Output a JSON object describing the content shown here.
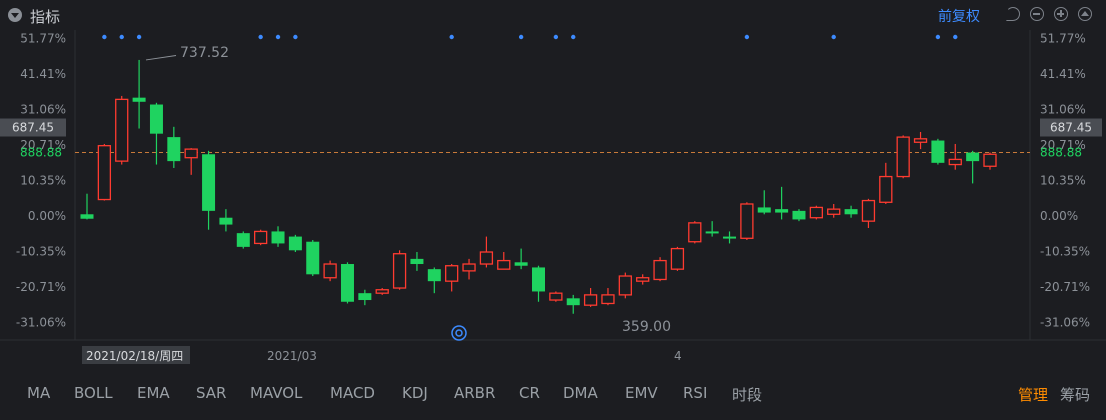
{
  "toolbar": {
    "title": "指标",
    "adjust_label": "前复权",
    "icons": [
      "collapse-icon",
      "undo-icon",
      "zoom-out-icon",
      "zoom-in-icon",
      "expand-icon"
    ]
  },
  "price_labels": {
    "high_label": "737.52",
    "low_label": "359.00",
    "current_price": "687.45",
    "dashed_price_label": "888.88"
  },
  "y_axis": {
    "ticks": [
      "51.77%",
      "41.41%",
      "31.06%",
      "20.71%",
      "10.35%",
      "0.00%",
      "-10.35%",
      "-20.71%",
      "-31.06%"
    ]
  },
  "x_axis": {
    "labels": [
      "2021/02/18/周四",
      "2021/03",
      "4"
    ]
  },
  "indicators": [
    "MA",
    "BOLL",
    "EMA",
    "SAR",
    "MAVOL",
    "MACD",
    "KDJ",
    "ARBR",
    "CR",
    "DMA",
    "EMV",
    "RSI",
    "时段"
  ],
  "accent_buttons": [
    "管理",
    "筹码"
  ],
  "colors": {
    "up": "#ff3b30",
    "down": "#1fd360",
    "accent": "#3d8bff",
    "dashed": "#c87a3a",
    "orange": "#ff8c00"
  },
  "chart_data": {
    "type": "candlestick",
    "y_unit": "percent change",
    "ylim": [
      -36,
      56
    ],
    "candles": [
      {
        "o": 0.5,
        "c": -0.8,
        "h": 6.5,
        "l": -1.0
      },
      {
        "o": 4.8,
        "c": 20.5,
        "h": 21.0,
        "l": 4.5
      },
      {
        "o": 16.0,
        "c": 34.0,
        "h": 35.0,
        "l": 15.0
      },
      {
        "o": 34.5,
        "c": 33.3,
        "h": 45.5,
        "l": 25.5
      },
      {
        "o": 32.5,
        "c": 24.0,
        "h": 33.0,
        "l": 15.0
      },
      {
        "o": 23.0,
        "c": 16.0,
        "h": 26.0,
        "l": 14.0
      },
      {
        "o": 17.0,
        "c": 19.5,
        "h": 19.8,
        "l": 12.0
      },
      {
        "o": 18.0,
        "c": 1.5,
        "h": 19.0,
        "l": -4.0
      },
      {
        "o": -0.5,
        "c": -2.5,
        "h": 2.0,
        "l": -4.5
      },
      {
        "o": -5.0,
        "c": -9.0,
        "h": -4.5,
        "l": -9.5
      },
      {
        "o": -8.0,
        "c": -4.5,
        "h": -4.0,
        "l": -8.5
      },
      {
        "o": -4.5,
        "c": -8.0,
        "h": -3.0,
        "l": -9.0
      },
      {
        "o": -6.0,
        "c": -10.0,
        "h": -5.5,
        "l": -10.5
      },
      {
        "o": -7.5,
        "c": -17.0,
        "h": -7.0,
        "l": -17.5
      },
      {
        "o": -18.0,
        "c": -14.0,
        "h": -13.0,
        "l": -19.0
      },
      {
        "o": -14.0,
        "c": -25.0,
        "h": -13.5,
        "l": -25.5
      },
      {
        "o": -22.5,
        "c": -24.5,
        "h": -21.5,
        "l": -26.0
      },
      {
        "o": -22.5,
        "c": -21.5,
        "h": -21.0,
        "l": -23.0
      },
      {
        "o": -21.0,
        "c": -11.0,
        "h": -10.0,
        "l": -21.5
      },
      {
        "o": -12.5,
        "c": -14.0,
        "h": -10.5,
        "l": -16.0
      },
      {
        "o": -15.5,
        "c": -19.0,
        "h": -15.0,
        "l": -22.5
      },
      {
        "o": -19.0,
        "c": -14.5,
        "h": -14.0,
        "l": -22.0
      },
      {
        "o": -16.0,
        "c": -14.0,
        "h": -12.5,
        "l": -18.5
      },
      {
        "o": -14.0,
        "c": -10.5,
        "h": -6.0,
        "l": -15.0
      },
      {
        "o": -15.5,
        "c": -13.0,
        "h": -10.5,
        "l": -15.5
      },
      {
        "o": -13.5,
        "c": -14.5,
        "h": -9.5,
        "l": -15.5
      },
      {
        "o": -15.0,
        "c": -22.0,
        "h": -14.5,
        "l": -25.0
      },
      {
        "o": -24.5,
        "c": -22.5,
        "h": -22.0,
        "l": -25.0
      },
      {
        "o": -24.0,
        "c": -26.0,
        "h": -23.0,
        "l": -28.5
      },
      {
        "o": -26.0,
        "c": -23.0,
        "h": -21.0,
        "l": -26.5
      },
      {
        "o": -25.5,
        "c": -23.0,
        "h": -21.0,
        "l": -26.0
      },
      {
        "o": -23.0,
        "c": -17.5,
        "h": -16.5,
        "l": -24.0
      },
      {
        "o": -19.0,
        "c": -18.0,
        "h": -17.0,
        "l": -20.0
      },
      {
        "o": -18.5,
        "c": -13.0,
        "h": -12.0,
        "l": -19.0
      },
      {
        "o": -15.5,
        "c": -9.5,
        "h": -9.0,
        "l": -16.0
      },
      {
        "o": -7.5,
        "c": -2.0,
        "h": -1.5,
        "l": -8.0
      },
      {
        "o": -4.5,
        "c": -5.0,
        "h": -1.5,
        "l": -6.0
      },
      {
        "o": -6.0,
        "c": -6.5,
        "h": -4.5,
        "l": -8.0
      },
      {
        "o": -6.5,
        "c": 3.5,
        "h": 4.0,
        "l": -7.0
      },
      {
        "o": 2.5,
        "c": 1.0,
        "h": 7.5,
        "l": 0.5
      },
      {
        "o": 2.0,
        "c": 1.0,
        "h": 8.5,
        "l": -1.0
      },
      {
        "o": 1.5,
        "c": -1.0,
        "h": 2.0,
        "l": -1.5
      },
      {
        "o": -0.5,
        "c": 2.5,
        "h": 3.0,
        "l": -1.0
      },
      {
        "o": 0.5,
        "c": 2.0,
        "h": 3.5,
        "l": -0.5
      },
      {
        "o": 2.0,
        "c": 0.5,
        "h": 3.0,
        "l": -0.5
      },
      {
        "o": -1.5,
        "c": 4.5,
        "h": 5.0,
        "l": -3.5
      },
      {
        "o": 4.0,
        "c": 11.5,
        "h": 15.5,
        "l": 3.5
      },
      {
        "o": 11.5,
        "c": 23.0,
        "h": 23.5,
        "l": 11.0
      },
      {
        "o": 21.5,
        "c": 22.5,
        "h": 24.5,
        "l": 19.5
      },
      {
        "o": 22.0,
        "c": 15.5,
        "h": 22.5,
        "l": 15.0
      },
      {
        "o": 15.0,
        "c": 16.5,
        "h": 21.0,
        "l": 13.5
      },
      {
        "o": 18.5,
        "c": 16.0,
        "h": 19.0,
        "l": 9.5
      },
      {
        "o": 14.5,
        "c": 18.0,
        "h": 18.5,
        "l": 13.5
      }
    ],
    "dashed_level": 18.5,
    "markers_count": 14
  }
}
